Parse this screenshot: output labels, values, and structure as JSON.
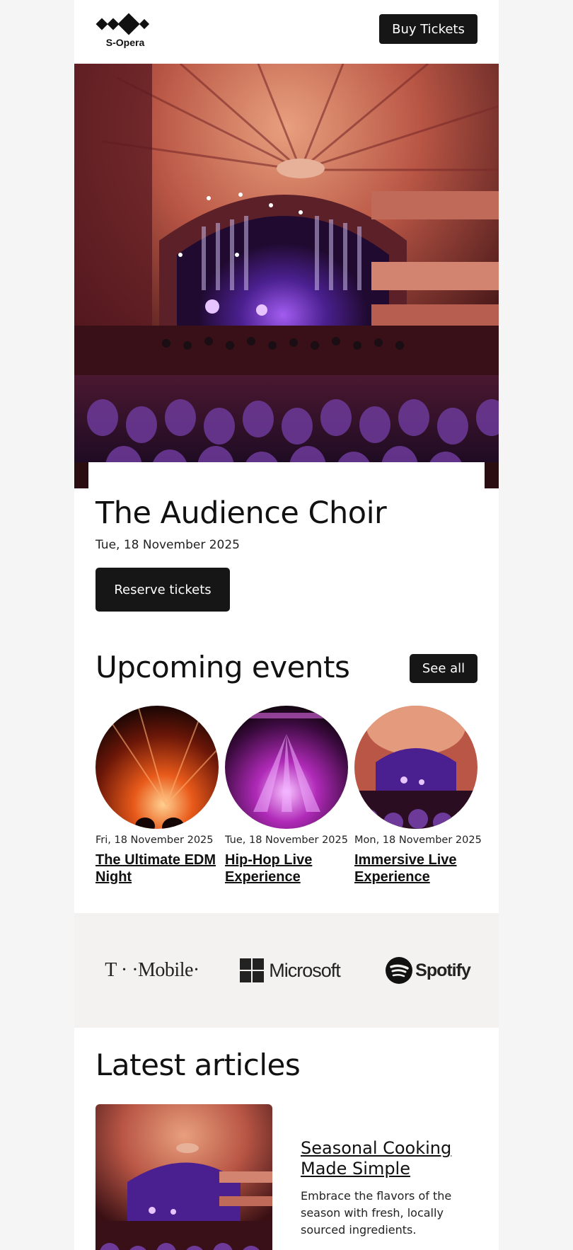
{
  "brand": {
    "name": "S-Opera"
  },
  "header": {
    "buy_label": "Buy Tickets"
  },
  "hero": {
    "title": "The Audience Choir",
    "date": "Tue, 18 November 2025",
    "cta_label": "Reserve tickets"
  },
  "upcoming": {
    "title": "Upcoming events",
    "see_all_label": "See all",
    "events": [
      {
        "date": "Fri, 18 November 2025",
        "name": "The Ultimate EDM Night"
      },
      {
        "date": "Tue, 18 November 2025",
        "name": "Hip-Hop Live Experience"
      },
      {
        "date": "Mon, 18 November 2025",
        "name": "Immersive Live Experience"
      }
    ]
  },
  "sponsors": {
    "items": [
      "T · ·Mobile·",
      "Microsoft",
      "Spotify"
    ]
  },
  "articles": {
    "title": "Latest articles",
    "items": [
      {
        "title": "Seasonal Cooking Made Simple",
        "description": "Embrace the flavors of the season with fresh, locally sourced ingredients."
      }
    ]
  },
  "colors": {
    "button_bg": "#161616",
    "sponsor_bg": "#f3f2f0",
    "page_bg": "#f5f5f5"
  }
}
